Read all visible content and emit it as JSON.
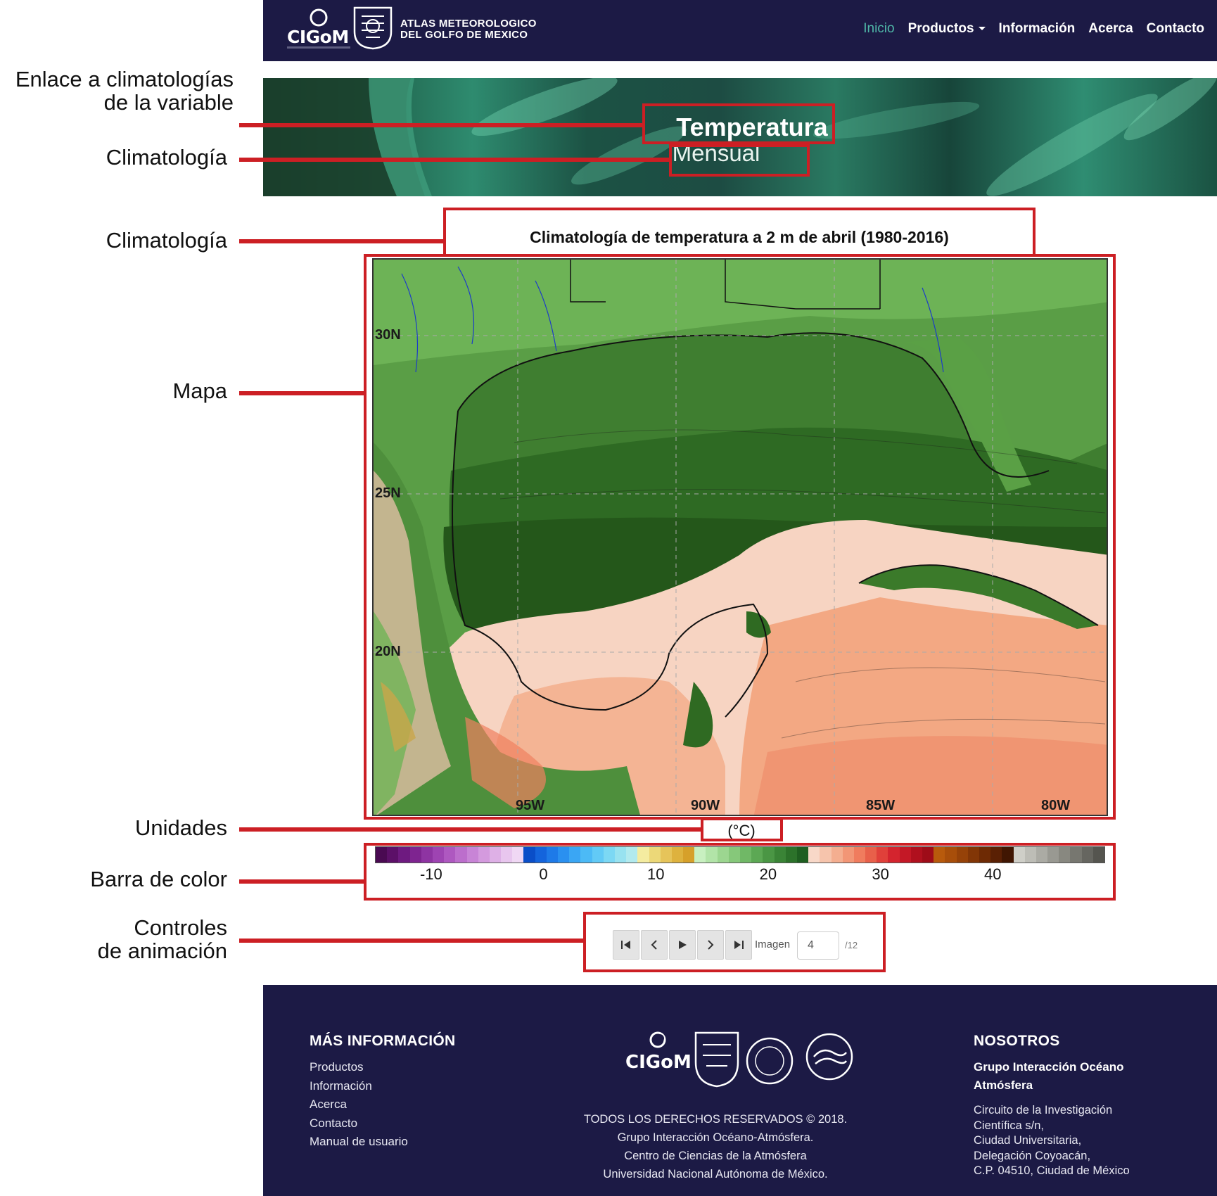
{
  "navbar": {
    "logo_text": "CIGoM",
    "title_line1": "ATLAS METEOROLOGICO",
    "title_line2": "DEL GOLFO DE MEXICO",
    "menu": [
      {
        "label": "Inicio",
        "active": true
      },
      {
        "label": "Productos",
        "dropdown": true
      },
      {
        "label": "Información"
      },
      {
        "label": "Acerca"
      },
      {
        "label": "Contacto"
      }
    ]
  },
  "hero": {
    "variable": "Temperatura",
    "subtitle": "Mensual"
  },
  "chart": {
    "title": "Climatología de temperatura a 2 m de abril (1980-2016)",
    "lat_labels": [
      "30N",
      "25N",
      "20N"
    ],
    "lon_labels": [
      "95W",
      "90W",
      "85W",
      "80W"
    ],
    "units": "(°C)"
  },
  "chart_data": {
    "type": "heatmap",
    "title": "Climatología de temperatura a 2 m de abril (1980-2016)",
    "units": "(°C)",
    "x_ticks": [
      "95W",
      "90W",
      "85W",
      "80W"
    ],
    "y_ticks": [
      "30N",
      "25N",
      "20N"
    ],
    "colorbar_ticks": [
      -10,
      0,
      10,
      20,
      30,
      40
    ],
    "colorbar_range": [
      -15,
      50
    ],
    "colorbar_colors": [
      "#4a0a52",
      "#5c1068",
      "#6e1a80",
      "#7e2490",
      "#8e34a2",
      "#9e44b2",
      "#ae58c0",
      "#bc6ecc",
      "#c884d6",
      "#d49ade",
      "#deb0e6",
      "#e8c6ee",
      "#f0d8f4",
      "#0a4ec8",
      "#1464dc",
      "#1e7ae8",
      "#2a90f0",
      "#3aa6f4",
      "#4cbaf6",
      "#62caf6",
      "#7cd8f4",
      "#98e2f0",
      "#b2eaee",
      "#f4eca0",
      "#ecd878",
      "#e6c45a",
      "#deb23e",
      "#d6a02a",
      "#c8f0c0",
      "#b2e4a8",
      "#9cd690",
      "#86c87a",
      "#70b866",
      "#5ca854",
      "#4a9644",
      "#3a8436",
      "#2c722a",
      "#1e5e20",
      "#f8d8c8",
      "#f6c4ac",
      "#f4ae90",
      "#f29676",
      "#f07c5e",
      "#e8604a",
      "#e0403a",
      "#d4242e",
      "#c41826",
      "#b0101e",
      "#9e0c18",
      "#b85a0c",
      "#a84e0a",
      "#964208",
      "#823606",
      "#6e2a04",
      "#5a2004",
      "#401602",
      "#cfcfc8",
      "#bdbdb6",
      "#ababa4",
      "#999992",
      "#888880",
      "#777770",
      "#666660",
      "#55554f"
    ]
  },
  "controls": {
    "first": "first-frame",
    "prev": "previous-frame",
    "play": "play",
    "next": "next-frame",
    "last": "last-frame",
    "image_label": "Imagen",
    "image_value": "4",
    "image_total": "/12"
  },
  "footer": {
    "more_info_heading": "MÁS INFORMACIÓN",
    "links": [
      "Productos",
      "Información",
      "Acerca",
      "Contacto",
      "Manual de usuario"
    ],
    "rights": [
      "TODOS LOS DERECHOS RESERVADOS © 2018.",
      "Grupo Interacción Océano-Atmósfera.",
      "Centro de Ciencias de la Atmósfera",
      "Universidad Nacional Autónoma de México."
    ],
    "about_heading": "NOSOTROS",
    "group_line1": "Grupo Interacción Océano",
    "group_line2": "Atmósfera",
    "address": [
      "Circuito de la Investigación",
      "Científica s/n,",
      "Ciudad Universitaria,",
      "Delegación Coyoacán,",
      "C.P. 04510, Ciudad de México"
    ],
    "logo_text": "CIGoM"
  },
  "annotations": {
    "variable_link_line1": "Enlace a climatologías",
    "variable_link_line2": "de la variable",
    "climatology_1": "Climatología",
    "climatology_2": "Climatología",
    "map": "Mapa",
    "units": "Unidades",
    "colorbar": "Barra de color",
    "controls_line1": "Controles",
    "controls_line2": "de animación",
    "line_color": "#cc1f24"
  },
  "colors": {
    "navbar_bg": "#1c1a45",
    "active_link": "#4fb8a8",
    "annotation_red": "#cc1f24"
  }
}
